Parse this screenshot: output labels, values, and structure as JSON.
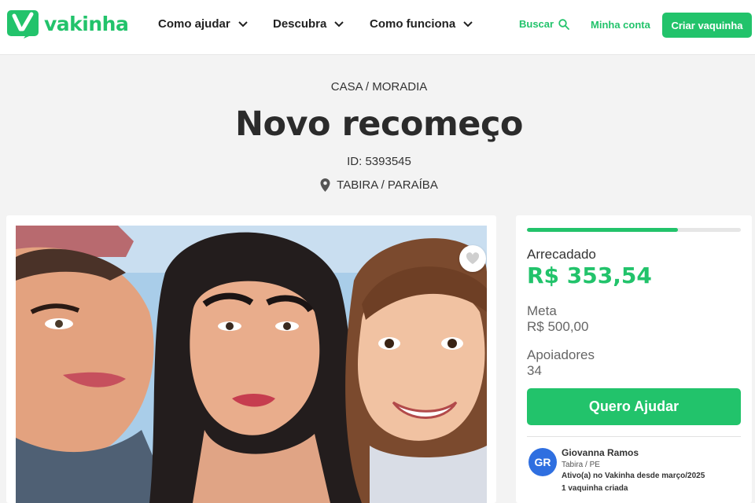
{
  "brand": {
    "name": "vakinha",
    "color": "#22c36b"
  },
  "nav": {
    "items": [
      {
        "label": "Como ajudar"
      },
      {
        "label": "Descubra"
      },
      {
        "label": "Como funciona"
      }
    ],
    "search_label": "Buscar",
    "account_label": "Minha conta",
    "create_label": "Criar vaquinha"
  },
  "campaign": {
    "category": "CASA / MORADIA",
    "title": "Novo recomeço",
    "id_text": "ID: 5393545",
    "location": "TABIRA / PARAÍBA"
  },
  "stats": {
    "raised_label": "Arrecadado",
    "raised_value": "R$ 353,54",
    "goal_label": "Meta",
    "goal_value": "R$ 500,00",
    "supporters_label": "Apoiadores",
    "supporters_value": "34",
    "progress_fraction": 0.707,
    "help_button": "Quero Ajudar"
  },
  "organizer": {
    "initials": "GR",
    "name": "Giovanna Ramos",
    "location": "Tabira / PE",
    "active_since": "Ativo(a) no Vakinha desde março/2025",
    "campaigns_count": "1 vaquinha criada"
  }
}
